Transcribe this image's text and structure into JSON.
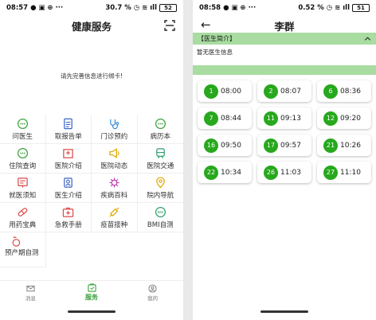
{
  "left": {
    "status": {
      "time": "08:57",
      "extra": "···",
      "battery_pct": "30.7 %",
      "battery_level": "52"
    },
    "header": {
      "title": "健康服务"
    },
    "message": "请先完善信息进行绑卡!",
    "services": [
      {
        "label": "问医生",
        "icon": "chat-bubble-icon"
      },
      {
        "label": "取报告单",
        "icon": "report-document-icon"
      },
      {
        "label": "门诊预约",
        "icon": "stethoscope-icon"
      },
      {
        "label": "病历本",
        "icon": "chat-bubble-icon"
      },
      {
        "label": "住院查询",
        "icon": "chat-bubble-icon"
      },
      {
        "label": "医院介绍",
        "icon": "hospital-building-icon"
      },
      {
        "label": "医院动态",
        "icon": "megaphone-icon"
      },
      {
        "label": "医院交通",
        "icon": "bus-icon"
      },
      {
        "label": "就医须知",
        "icon": "notice-board-icon"
      },
      {
        "label": "医生介绍",
        "icon": "doctor-badge-icon"
      },
      {
        "label": "疾病百科",
        "icon": "virus-icon"
      },
      {
        "label": "院内导航",
        "icon": "location-pin-icon"
      },
      {
        "label": "用药宝典",
        "icon": "pill-capsule-icon"
      },
      {
        "label": "急救手册",
        "icon": "first-aid-kit-icon"
      },
      {
        "label": "疫苗接种",
        "icon": "syringe-icon"
      },
      {
        "label": "BMI自测",
        "icon": "bmi-scale-icon"
      },
      {
        "label": "预产期自测",
        "icon": "pregnancy-icon"
      }
    ],
    "tabs": [
      {
        "label": "消息",
        "icon": "message-envelope-icon"
      },
      {
        "label": "服务",
        "icon": "service-box-icon"
      },
      {
        "label": "我的",
        "icon": "profile-icon"
      }
    ],
    "active_tab": 1,
    "colors": {
      "accent": "#27a81d",
      "soft_green": "#a8dca0"
    }
  },
  "right": {
    "status": {
      "time": "08:58",
      "extra": "···",
      "battery_pct": "0.52 %",
      "battery_level": "51"
    },
    "header": {
      "title": "李群",
      "back_icon": "back-arrow-icon"
    },
    "doctor_intro": {
      "label": "【医生简介】",
      "toggle_icon": "chevron-up-icon",
      "text": "暂无医生信息"
    },
    "slots": [
      {
        "number": "1",
        "time": "08:00"
      },
      {
        "number": "2",
        "time": "08:07"
      },
      {
        "number": "6",
        "time": "08:36"
      },
      {
        "number": "7",
        "time": "08:44"
      },
      {
        "number": "11",
        "time": "09:13"
      },
      {
        "number": "12",
        "time": "09:20"
      },
      {
        "number": "16",
        "time": "09:50"
      },
      {
        "number": "17",
        "time": "09:57"
      },
      {
        "number": "21",
        "time": "10:26"
      },
      {
        "number": "22",
        "time": "10:34"
      },
      {
        "number": "26",
        "time": "11:03"
      },
      {
        "number": "27",
        "time": "11:10"
      }
    ]
  }
}
